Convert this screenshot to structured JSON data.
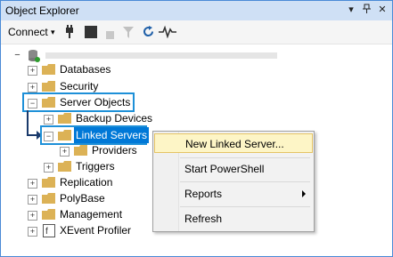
{
  "window": {
    "title": "Object Explorer"
  },
  "titlebar_icons": [
    "dropdown-arrow-icon",
    "pin-icon",
    "close-icon"
  ],
  "toolbar": {
    "connect_label": "Connect",
    "icons": [
      "connect-dropdown-icon",
      "plug-icon",
      "stop-icon",
      "disconnect-icon",
      "filter-icon",
      "refresh-icon",
      "activity-monitor-icon"
    ]
  },
  "tree": {
    "server_label": "",
    "nodes": {
      "databases": "Databases",
      "security": "Security",
      "server_objects": "Server Objects",
      "backup_devices": "Backup Devices",
      "linked_servers": "Linked Servers",
      "providers": "Providers",
      "triggers": "Triggers",
      "replication": "Replication",
      "polybase": "PolyBase",
      "management": "Management",
      "xevent_profiler": "XEvent Profiler"
    }
  },
  "context_menu": {
    "items": [
      {
        "label": "New Linked Server...",
        "highlighted": true
      },
      {
        "label": "Start PowerShell"
      },
      {
        "label": "Reports",
        "submenu": true
      },
      {
        "label": "Refresh"
      }
    ]
  },
  "colors": {
    "selection": "#0078d7",
    "highlight_box": "#1e90d8",
    "menu_hover": "#fdf5c6",
    "folder": "#dcb256"
  }
}
